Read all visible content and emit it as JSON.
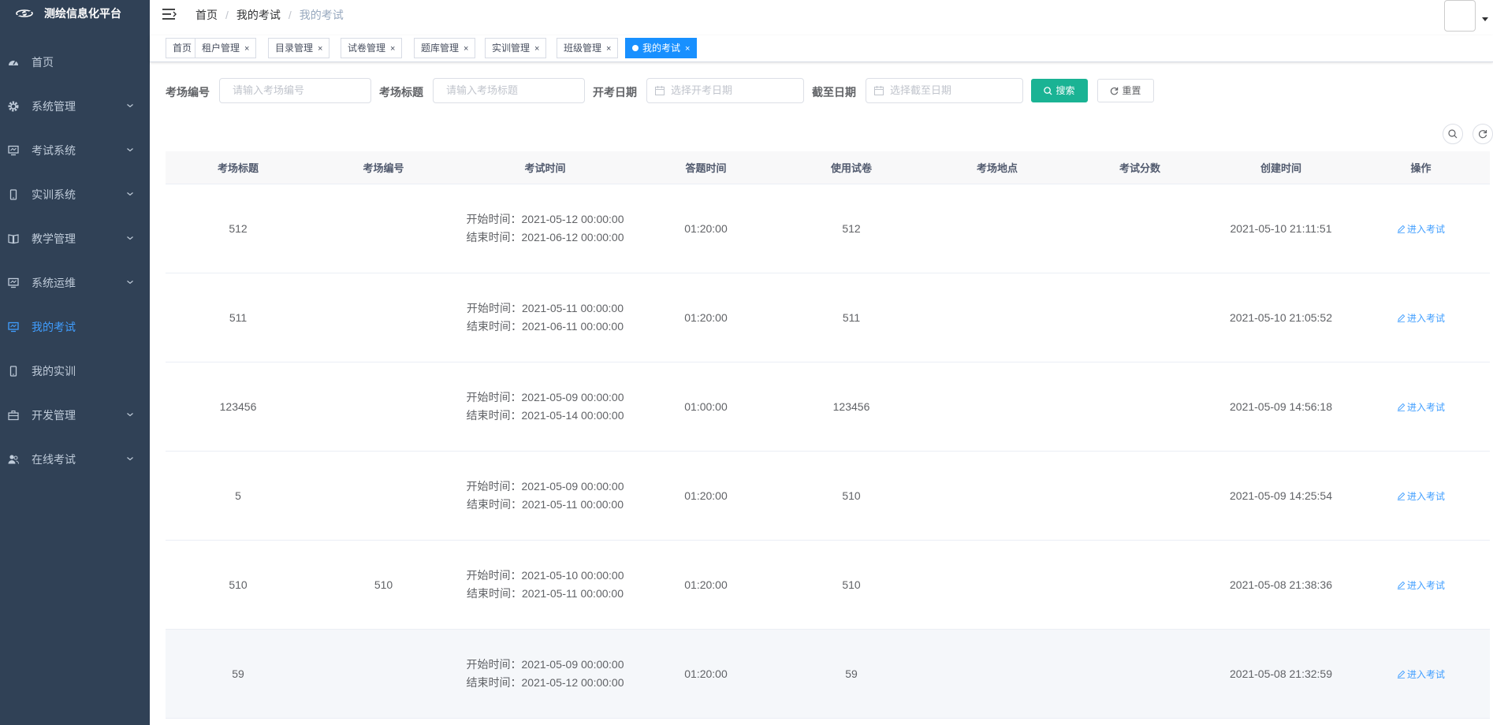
{
  "app": {
    "title": "测绘信息化平台"
  },
  "sidebar": {
    "items": [
      {
        "label": "首页",
        "icon": "dashboard-icon",
        "arrow": false,
        "active": false
      },
      {
        "label": "系统管理",
        "icon": "gear-icon",
        "arrow": true,
        "active": false
      },
      {
        "label": "考试系统",
        "icon": "monitor-icon",
        "arrow": true,
        "active": false
      },
      {
        "label": "实训系统",
        "icon": "phone-icon",
        "arrow": true,
        "active": false
      },
      {
        "label": "教学管理",
        "icon": "book-icon",
        "arrow": true,
        "active": false
      },
      {
        "label": "系统运维",
        "icon": "monitor-icon",
        "arrow": true,
        "active": false
      },
      {
        "label": "我的考试",
        "icon": "monitor-icon",
        "arrow": false,
        "active": true
      },
      {
        "label": "我的实训",
        "icon": "phone-icon",
        "arrow": false,
        "active": false
      },
      {
        "label": "开发管理",
        "icon": "toolbox-icon",
        "arrow": true,
        "active": false
      },
      {
        "label": "在线考试",
        "icon": "users-icon",
        "arrow": true,
        "active": false
      }
    ]
  },
  "breadcrumb": [
    "首页",
    "我的考试",
    "我的考试"
  ],
  "tags": [
    {
      "label": "首页",
      "closable": false,
      "active": false
    },
    {
      "label": "租户管理",
      "closable": true,
      "active": false
    },
    {
      "label": "目录管理",
      "closable": true,
      "active": false
    },
    {
      "label": "试卷管理",
      "closable": true,
      "active": false
    },
    {
      "label": "题库管理",
      "closable": true,
      "active": false
    },
    {
      "label": "实训管理",
      "closable": true,
      "active": false
    },
    {
      "label": "班级管理",
      "closable": true,
      "active": false
    },
    {
      "label": "我的考试",
      "closable": true,
      "active": true
    }
  ],
  "search": {
    "code_label": "考场编号",
    "code_placeholder": "请输入考场编号",
    "title_label": "考场标题",
    "title_placeholder": "请输入考场标题",
    "start_label": "开考日期",
    "start_placeholder": "选择开考日期",
    "end_label": "截至日期",
    "end_placeholder": "选择截至日期",
    "search_button": "搜索",
    "reset_button": "重置"
  },
  "table": {
    "columns": [
      "考场标题",
      "考场编号",
      "考试时间",
      "答题时间",
      "使用试卷",
      "考场地点",
      "考试分数",
      "创建时间",
      "操作"
    ],
    "start_prefix": "开始时间：",
    "end_prefix": "结束时间：",
    "action_label": "进入考试",
    "rows": [
      {
        "title": "512",
        "code": "",
        "start": "2021-05-12 00:00:00",
        "end": "2021-06-12 00:00:00",
        "duration": "01:20:00",
        "paper": "512",
        "location": "",
        "score": "",
        "created": "2021-05-10 21:11:51"
      },
      {
        "title": "511",
        "code": "",
        "start": "2021-05-11 00:00:00",
        "end": "2021-06-11 00:00:00",
        "duration": "01:20:00",
        "paper": "511",
        "location": "",
        "score": "",
        "created": "2021-05-10 21:05:52"
      },
      {
        "title": "123456",
        "code": "",
        "start": "2021-05-09 00:00:00",
        "end": "2021-05-14 00:00:00",
        "duration": "01:00:00",
        "paper": "123456",
        "location": "",
        "score": "",
        "created": "2021-05-09 14:56:18"
      },
      {
        "title": "5",
        "code": "",
        "start": "2021-05-09 00:00:00",
        "end": "2021-05-11 00:00:00",
        "duration": "01:20:00",
        "paper": "510",
        "location": "",
        "score": "",
        "created": "2021-05-09 14:25:54"
      },
      {
        "title": "510",
        "code": "510",
        "start": "2021-05-10 00:00:00",
        "end": "2021-05-11 00:00:00",
        "duration": "01:20:00",
        "paper": "510",
        "location": "",
        "score": "",
        "created": "2021-05-08 21:38:36"
      },
      {
        "title": "59",
        "code": "",
        "start": "2021-05-09 00:00:00",
        "end": "2021-05-12 00:00:00",
        "duration": "01:20:00",
        "paper": "59",
        "location": "",
        "score": "",
        "created": "2021-05-08 21:32:59"
      }
    ]
  }
}
